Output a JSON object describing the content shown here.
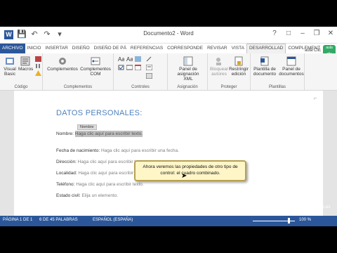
{
  "window": {
    "app_icon": "W",
    "title": "Documento2 - Word",
    "qat": [
      "save-icon",
      "undo-icon",
      "redo-icon",
      "customize-icon"
    ],
    "controls": [
      "?",
      "□",
      "–",
      "❐",
      "✕"
    ]
  },
  "tabs": [
    {
      "label": "ARCHIVO"
    },
    {
      "label": "INICIO"
    },
    {
      "label": "INSERTAR"
    },
    {
      "label": "DISEÑO"
    },
    {
      "label": "DISEÑO DE PÁ"
    },
    {
      "label": "REFERENCIAS"
    },
    {
      "label": "CORRESPONDE"
    },
    {
      "label": "REVISAR"
    },
    {
      "label": "VISTA"
    },
    {
      "label": "DESARROLLAD"
    },
    {
      "label": "COMPLEMENT"
    }
  ],
  "brand": {
    "name": "aula Clic",
    "logo_text": "aula clic"
  },
  "ribbon": {
    "codigo": {
      "visual_basic": "Visual Basic",
      "macros": "Macros",
      "group_label": "Código"
    },
    "complementos": {
      "btn1": "Complementos",
      "btn2": "Complementos COM",
      "group_label": "Complementos"
    },
    "controles": {
      "group_label": "Controles"
    },
    "asignacion": {
      "btn": "Panel de asignación XML",
      "group_label": "Asignación"
    },
    "proteger": {
      "btn1": "Bloquear autores",
      "btn2": "Restringir edición",
      "group_label": "Proteger"
    },
    "plantillas": {
      "btn1": "Plantilla de documento",
      "btn2": "Panel de documentos",
      "group_label": "Plantillas"
    }
  },
  "document": {
    "heading": "DATOS PERSONALES:",
    "cc_tag": "Nombre",
    "fields": [
      {
        "label": "Nombre:",
        "placeholder": "Haga clic aquí para escribir texto."
      },
      {
        "label": "Fecha de nacimiento:",
        "placeholder": "Haga clic aquí para escribir una fecha."
      },
      {
        "label": "Dirección:",
        "placeholder": "Haga clic aquí para escribir texto."
      },
      {
        "label": "Localidad:",
        "placeholder": "Haga clic aquí para escribir texto."
      },
      {
        "label": "Teléfono:",
        "placeholder": "Haga clic aquí para escribir texto."
      },
      {
        "label": "Estado civil:",
        "placeholder": "Elija un elemento."
      }
    ]
  },
  "status": {
    "page": "PÁGINA 1 DE 1",
    "words": "6 DE 45 PALABRAS",
    "language": "ESPAÑOL (ESPAÑA)",
    "zoom": "100 %"
  },
  "callout": "Ahora veremos las propiedades de otro tipo de control: el cuadro combinado.",
  "watermark": "www.aulaclic.es",
  "colors": {
    "accent": "#2b579a",
    "heading": "#4f81bd",
    "callout_bg": "#fff6c8"
  }
}
